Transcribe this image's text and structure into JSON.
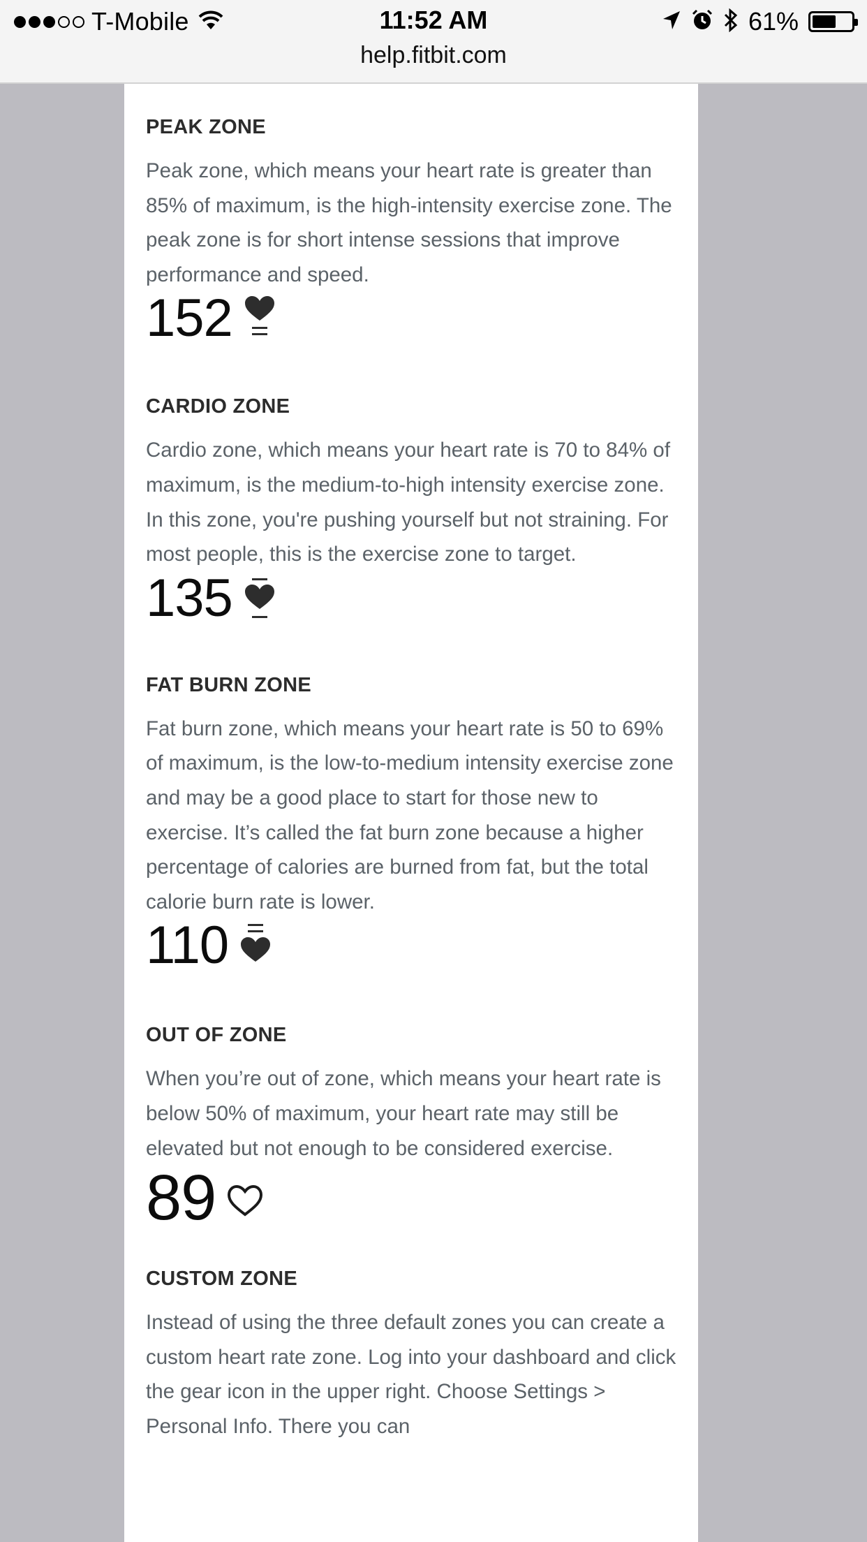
{
  "status_bar": {
    "carrier": "T-Mobile",
    "time": "11:52 AM",
    "battery": "61%",
    "battery_level": 0.61,
    "signal_bars": 3,
    "signal_total": 5
  },
  "browser": {
    "url": "help.fitbit.com"
  },
  "zones": [
    {
      "title": "PEAK ZONE",
      "description": "Peak zone, which means your heart rate is greater than 85% of maximum, is the high-intensity exercise zone. The peak zone is for short intense sessions that improve performance and speed.",
      "value": "152",
      "icon": "heart-peak-icon"
    },
    {
      "title": "CARDIO ZONE",
      "description": "Cardio zone, which means your heart rate is 70 to 84% of maximum, is the medium-to-high intensity exercise zone. In this zone, you're pushing yourself but not straining. For most people, this is the exercise zone to target.",
      "value": "135",
      "icon": "heart-cardio-icon"
    },
    {
      "title": "FAT BURN ZONE",
      "description": "Fat burn zone, which means your heart rate is 50 to 69% of maximum, is the low-to-medium intensity exercise zone and may be a good place to start for those new to exercise. It’s called the fat burn zone because a higher percentage of calories are burned from fat, but the total calorie burn rate is lower.",
      "value": "110",
      "icon": "heart-fat-burn-icon"
    },
    {
      "title": "OUT OF ZONE",
      "description": "When you’re out of zone, which means your heart rate is below 50% of maximum, your heart rate may still be elevated but not enough to be considered exercise.",
      "value": "89",
      "icon": "heart-outline-icon"
    },
    {
      "title": "CUSTOM ZONE",
      "description": "Instead of using the three default zones you can create a custom heart rate zone. Log into your dashboard and click the gear icon in the upper right. Choose Settings > Personal Info. There you can"
    }
  ]
}
